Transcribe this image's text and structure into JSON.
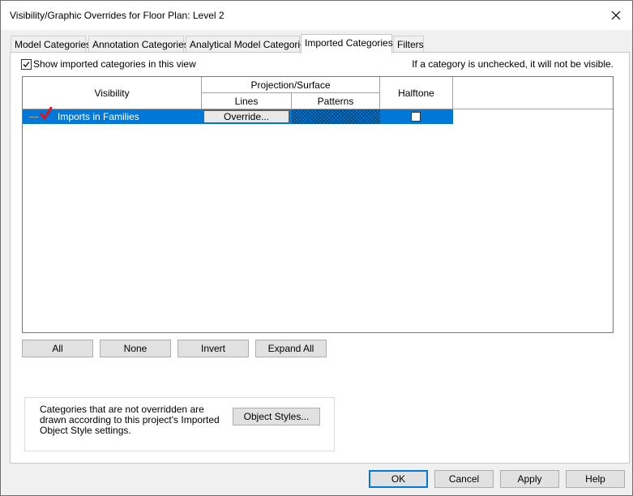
{
  "window": {
    "title": "Visibility/Graphic Overrides for Floor Plan: Level 2"
  },
  "tabs": [
    {
      "label": "Model Categories",
      "active": false
    },
    {
      "label": "Annotation Categories",
      "active": false
    },
    {
      "label": "Analytical Model Categories",
      "active": false
    },
    {
      "label": "Imported Categories",
      "active": true
    },
    {
      "label": "Filters",
      "active": false
    }
  ],
  "panel": {
    "show_imported_label": "Show imported categories in this view",
    "show_imported_checked": true,
    "hint": "If a category is unchecked, it will not be visible."
  },
  "grid": {
    "headers": {
      "visibility": "Visibility",
      "projection_surface": "Projection/Surface",
      "lines": "Lines",
      "patterns": "Patterns",
      "halftone": "Halftone"
    },
    "rows": [
      {
        "label": "Imports in Families",
        "visible_checked": true,
        "lines_button": "Override...",
        "halftone_checked": false,
        "selected": true
      }
    ]
  },
  "grid_buttons": {
    "all": "All",
    "none": "None",
    "invert": "Invert",
    "expand_all": "Expand All"
  },
  "note": {
    "text": "Categories that are not overridden are drawn according to this project's Imported Object Style settings.",
    "button": "Object Styles..."
  },
  "footer": {
    "ok": "OK",
    "cancel": "Cancel",
    "apply": "Apply",
    "help": "Help"
  },
  "colors": {
    "selection": "#0078d7",
    "check_red": "#e8101a",
    "dialog_bg": "#f0f0f0"
  },
  "icons": [
    "close-icon",
    "checkbox-checked-icon",
    "red-checkmark-icon",
    "checkbox-empty-icon"
  ]
}
